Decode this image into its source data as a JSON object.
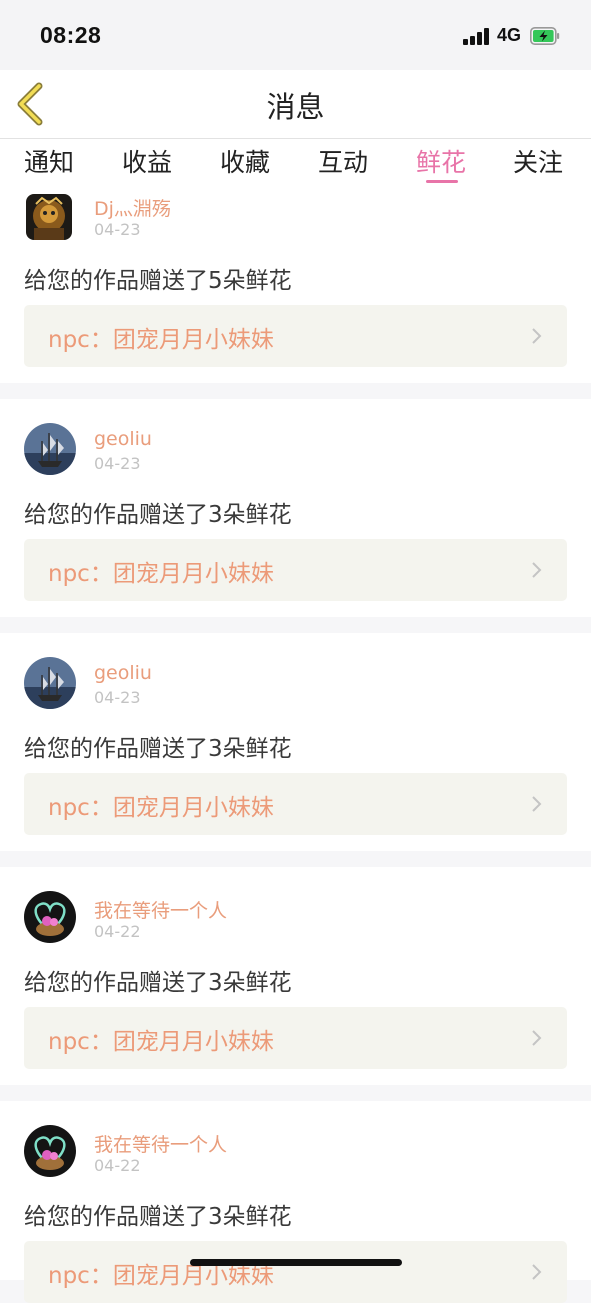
{
  "status_bar": {
    "time": "08:28",
    "network": "4G"
  },
  "header": {
    "title": "消息"
  },
  "tabs": [
    {
      "label": "通知",
      "active": false
    },
    {
      "label": "收益",
      "active": false
    },
    {
      "label": "收藏",
      "active": false
    },
    {
      "label": "互动",
      "active": false
    },
    {
      "label": "鲜花",
      "active": true
    },
    {
      "label": "关注",
      "active": false
    }
  ],
  "colors": {
    "accent": "#e874a8",
    "username": "#e99d7c",
    "link_bg": "#f4f4ee"
  },
  "notifications": [
    {
      "user": "Dj灬淵殇",
      "date": "04-23",
      "message": "给您的作品赠送了5朵鲜花",
      "work": "npc：团宠月月小妹妹",
      "avatar": "monkey-king-avatar"
    },
    {
      "user": "geoliu",
      "date": "04-23",
      "message": "给您的作品赠送了3朵鲜花",
      "work": "npc：团宠月月小妹妹",
      "avatar": "sailing-ship-avatar"
    },
    {
      "user": "geoliu",
      "date": "04-23",
      "message": "给您的作品赠送了3朵鲜花",
      "work": "npc：团宠月月小妹妹",
      "avatar": "sailing-ship-avatar"
    },
    {
      "user": "我在等待一个人",
      "date": "04-22",
      "message": "给您的作品赠送了3朵鲜花",
      "work": "npc：团宠月月小妹妹",
      "avatar": "heart-avatar"
    },
    {
      "user": "我在等待一个人",
      "date": "04-22",
      "message": "给您的作品赠送了3朵鲜花",
      "work": "npc：团宠月月小妹妹",
      "avatar": "heart-avatar"
    }
  ]
}
